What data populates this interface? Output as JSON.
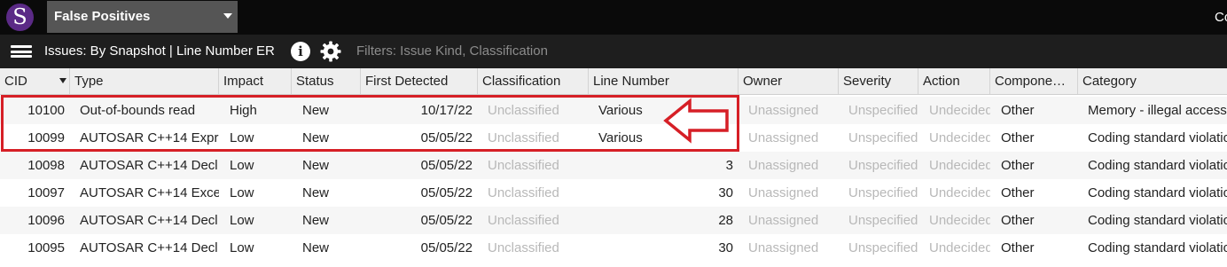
{
  "app": {
    "logo_letter": "S",
    "project_name": "False Positives",
    "top_right_text": "Co"
  },
  "toolbar": {
    "view_title": "Issues: By Snapshot | Line Number ER",
    "filters_text": "Filters: Issue Kind, Classification",
    "info_glyph": "i"
  },
  "columns": [
    "CID",
    "Type",
    "Impact",
    "Status",
    "First Detected",
    "Classification",
    "Line Number",
    "Owner",
    "Severity",
    "Action",
    "Compone…",
    "Category"
  ],
  "rows": [
    {
      "cid": "10100",
      "type": "Out-of-bounds read",
      "impact": "High",
      "status": "New",
      "first_detected": "10/17/22",
      "classification": "Unclassified",
      "line_number": "Various",
      "owner": "Unassigned",
      "severity": "Unspecified",
      "action": "Undecided",
      "component": "Other",
      "category": "Memory - illegal accesses"
    },
    {
      "cid": "10099",
      "type": "AUTOSAR C++14 Expr",
      "impact": "Low",
      "status": "New",
      "first_detected": "05/05/22",
      "classification": "Unclassified",
      "line_number": "Various",
      "owner": "Unassigned",
      "severity": "Unspecified",
      "action": "Undecided",
      "component": "Other",
      "category": "Coding standard violation"
    },
    {
      "cid": "10098",
      "type": "AUTOSAR C++14 Decl",
      "impact": "Low",
      "status": "New",
      "first_detected": "05/05/22",
      "classification": "Unclassified",
      "line_number": "3",
      "owner": "Unassigned",
      "severity": "Unspecified",
      "action": "Undecided",
      "component": "Other",
      "category": "Coding standard violation"
    },
    {
      "cid": "10097",
      "type": "AUTOSAR C++14 Exce",
      "impact": "Low",
      "status": "New",
      "first_detected": "05/05/22",
      "classification": "Unclassified",
      "line_number": "30",
      "owner": "Unassigned",
      "severity": "Unspecified",
      "action": "Undecided",
      "component": "Other",
      "category": "Coding standard violation"
    },
    {
      "cid": "10096",
      "type": "AUTOSAR C++14 Decl",
      "impact": "Low",
      "status": "New",
      "first_detected": "05/05/22",
      "classification": "Unclassified",
      "line_number": "28",
      "owner": "Unassigned",
      "severity": "Unspecified",
      "action": "Undecided",
      "component": "Other",
      "category": "Coding standard violation"
    },
    {
      "cid": "10095",
      "type": "AUTOSAR C++14 Decl",
      "impact": "Low",
      "status": "New",
      "first_detected": "05/05/22",
      "classification": "Unclassified",
      "line_number": "30",
      "owner": "Unassigned",
      "severity": "Unspecified",
      "action": "Undecided",
      "component": "Other",
      "category": "Coding standard violation"
    }
  ],
  "colors": {
    "topbar": "#0a0a0a",
    "toolbar": "#1e1e1e",
    "logo": "#5b2a86",
    "project_bg": "#555555",
    "highlight": "#d61f26",
    "muted_text": "#b8b8b8"
  }
}
